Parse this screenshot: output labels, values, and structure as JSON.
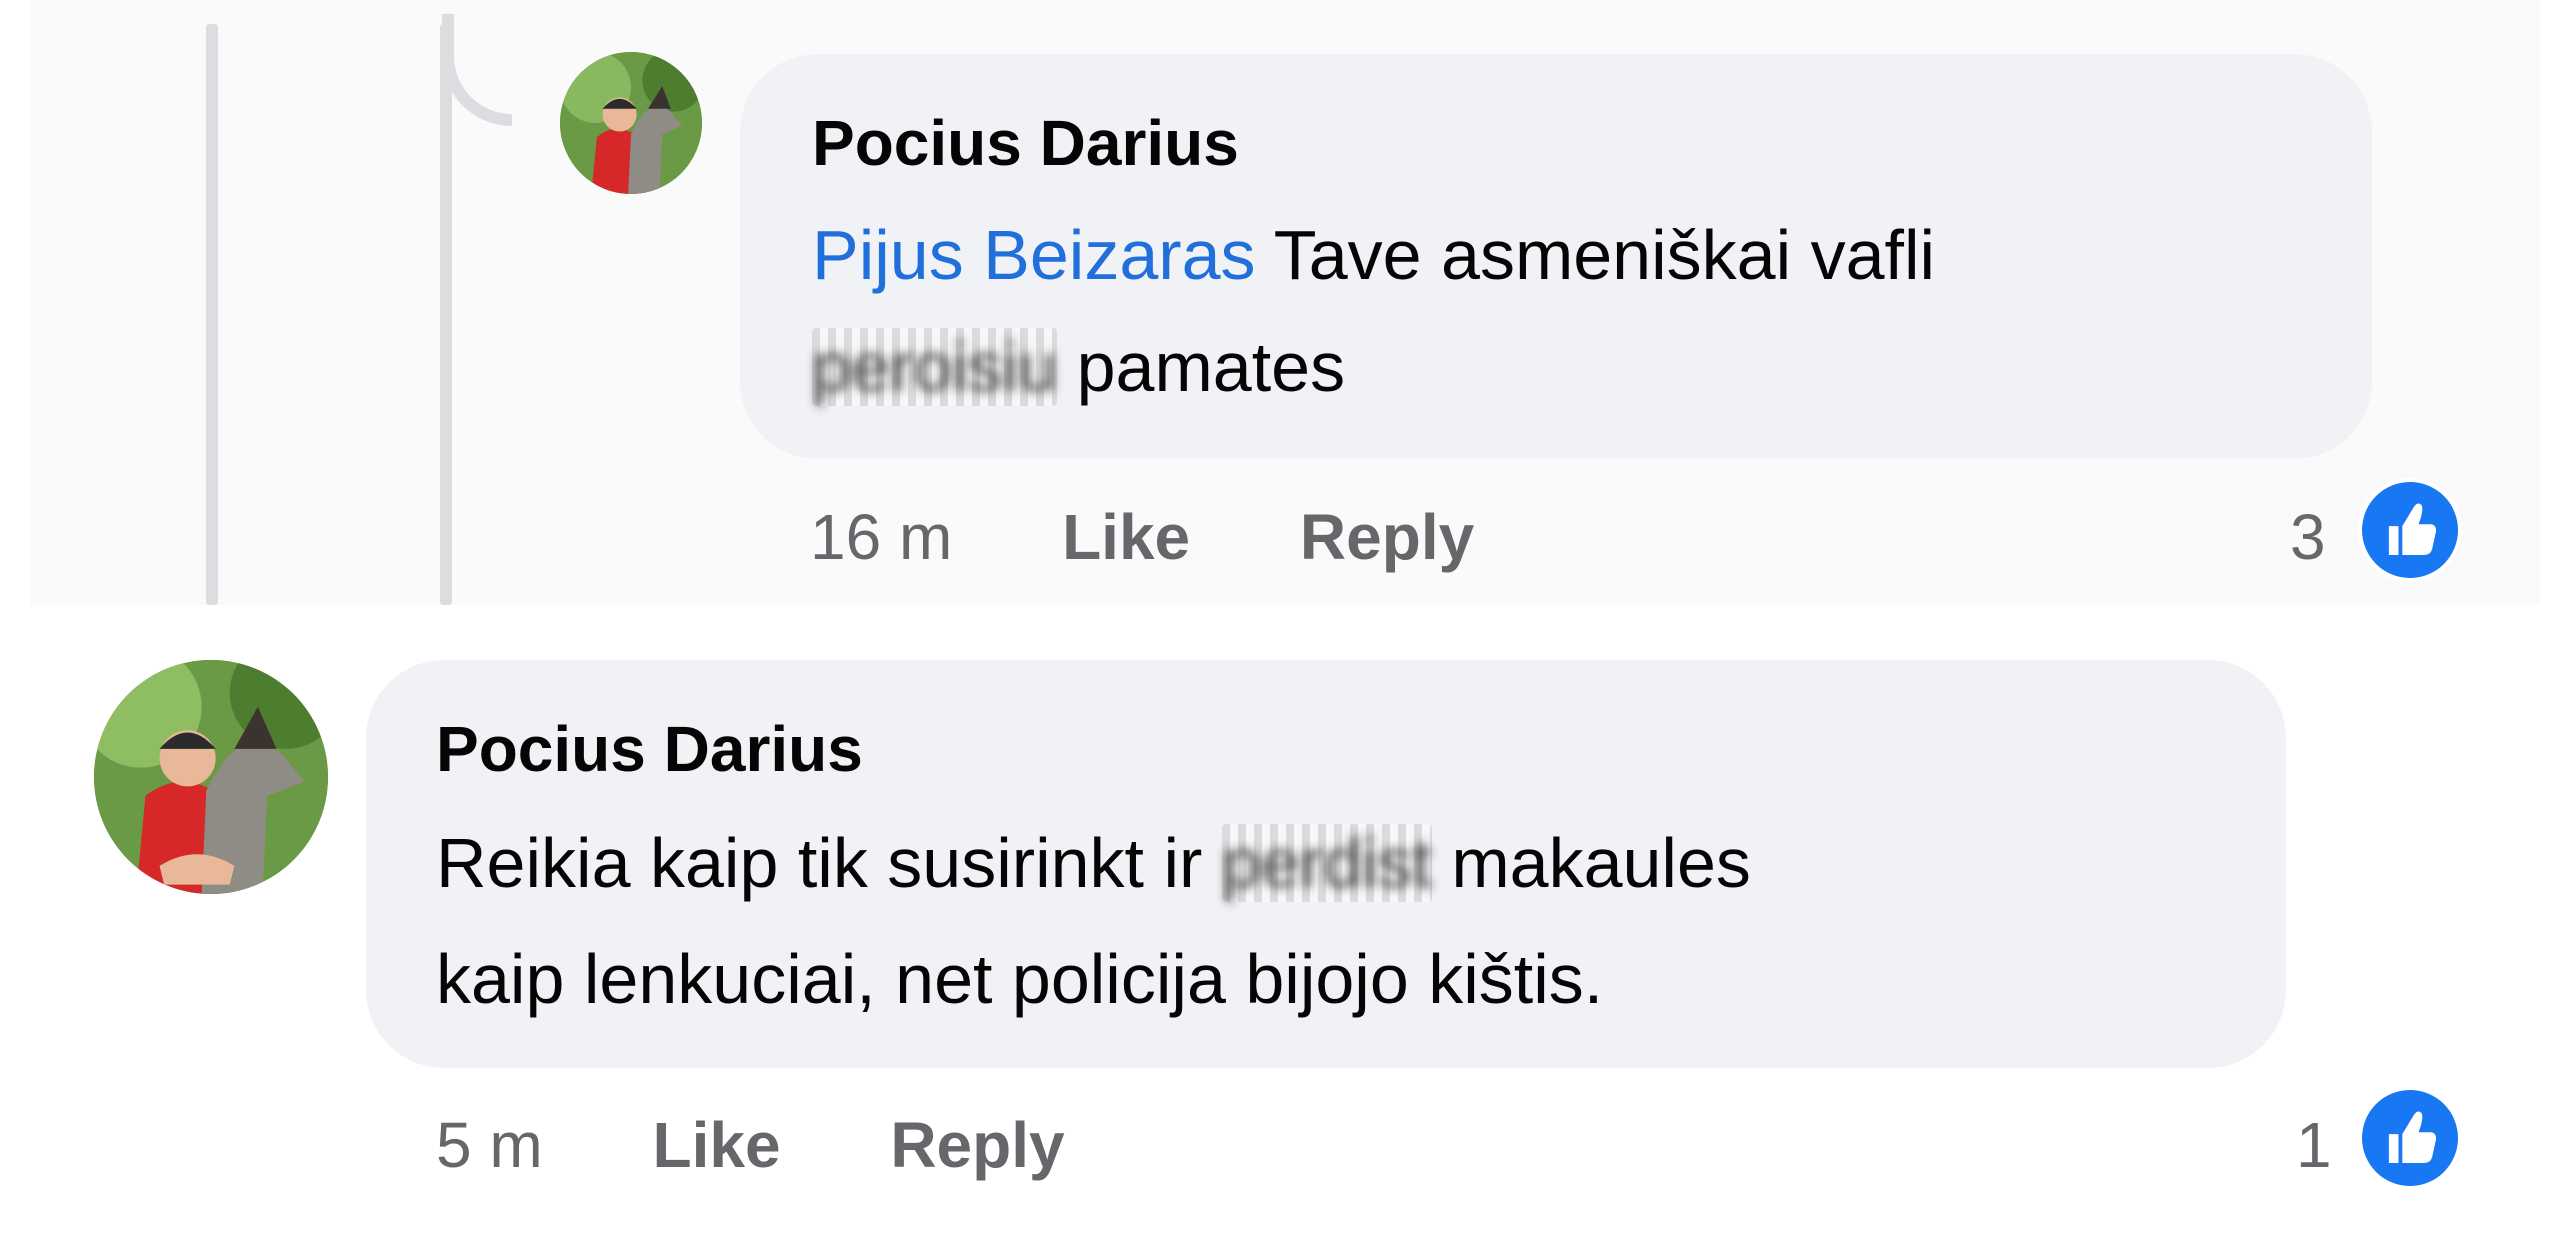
{
  "comments": [
    {
      "author": "Pocius Darius",
      "mention": "Pijus Beizaras",
      "text_line1": " Tave asmeniškai vafli",
      "redacted_line2": "peroisiu",
      "text_line2": " pamates",
      "time": "16 m",
      "like_label": "Like",
      "reply_label": "Reply",
      "reaction_count": "3",
      "reaction_icon": "thumbs-up-icon"
    },
    {
      "author": "Pocius Darius",
      "text_line1_a": "Reikia kaip tik susirinkt ir ",
      "redacted_line1": "perdist",
      "text_line1_b": " makaules",
      "text_line2": "kaip lenkuciai, net policija bijojo kištis.",
      "time": "5 m",
      "like_label": "Like",
      "reply_label": "Reply",
      "reaction_count": "1",
      "reaction_icon": "thumbs-up-icon"
    }
  ],
  "colors": {
    "bubble": "#f0f2f5",
    "mention": "#216fdb",
    "reaction": "#1877f2",
    "meta": "#65676b"
  }
}
